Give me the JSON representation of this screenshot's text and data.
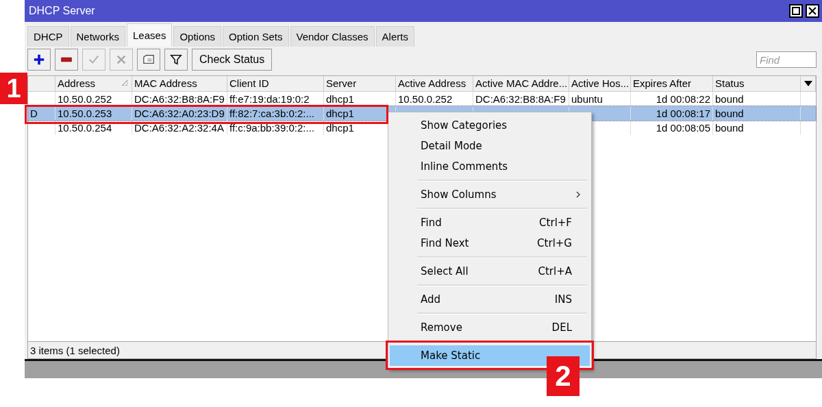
{
  "window": {
    "title": "DHCP Server"
  },
  "tabs": [
    {
      "label": "DHCP",
      "selected": false
    },
    {
      "label": "Networks",
      "selected": false
    },
    {
      "label": "Leases",
      "selected": true
    },
    {
      "label": "Options",
      "selected": false
    },
    {
      "label": "Option Sets",
      "selected": false
    },
    {
      "label": "Vendor Classes",
      "selected": false
    },
    {
      "label": "Alerts",
      "selected": false
    }
  ],
  "toolbar": {
    "buttons": [
      {
        "kind": "add",
        "disabled": false
      },
      {
        "kind": "remove",
        "disabled": false
      },
      {
        "kind": "enable",
        "disabled": true
      },
      {
        "kind": "disable",
        "disabled": true
      },
      {
        "kind": "comment",
        "disabled": false
      },
      {
        "kind": "filter",
        "disabled": false
      }
    ],
    "check_status": "Check Status",
    "search": {
      "placeholder": "Find"
    }
  },
  "table": {
    "columns": [
      {
        "sorted": false
      },
      {
        "label": "Address",
        "sorted": true
      },
      {
        "label": "MAC Address",
        "sorted": false
      },
      {
        "label": "Client ID",
        "sorted": false
      },
      {
        "label": "Server",
        "sorted": false
      },
      {
        "label": "Active Address",
        "sorted": false
      },
      {
        "label": "Active MAC Addre...",
        "sorted": false
      },
      {
        "label": "Active Hos...",
        "sorted": false
      },
      {
        "label": "Expires After",
        "sorted": false
      },
      {
        "label": "Status",
        "sorted": false
      }
    ],
    "rows": [
      {
        "selected": false,
        "cells": [
          "",
          "10.50.0.252",
          "DC:A6:32:B8:8A:F9",
          "ff:e7:19:da:19:0:2",
          "dhcp1",
          "10.50.0.252",
          "DC:A6:32:B8:8A:F9",
          "ubuntu",
          "1d 00:08:22",
          "bound"
        ]
      },
      {
        "selected": true,
        "cells": [
          "D",
          "10.50.0.253",
          "DC:A6:32:A0:23:D9",
          "ff:82:7:ca:3b:0:2:...",
          "dhcp1",
          "",
          "",
          "",
          "1d 00:08:17",
          "bound"
        ]
      },
      {
        "selected": false,
        "cells": [
          "",
          "10.50.0.254",
          "DC:A6:32:A2:32:4A",
          "ff:c:9a:bb:39:0:2:...",
          "dhcp1",
          "",
          "",
          "",
          "1d 00:08:05",
          "bound"
        ]
      }
    ]
  },
  "status_bar": "3 items (1 selected)",
  "context_menu": {
    "groups": [
      [
        {
          "label": "Show Categories",
          "submenu": false,
          "selected": false
        },
        {
          "label": "Detail Mode",
          "submenu": false,
          "selected": false
        },
        {
          "label": "Inline Comments",
          "submenu": false,
          "selected": false
        }
      ],
      [
        {
          "label": "Show Columns",
          "submenu": true,
          "selected": false
        }
      ],
      [
        {
          "label": "Find",
          "shortcut": "Ctrl+F",
          "submenu": false,
          "selected": false
        },
        {
          "label": "Find Next",
          "shortcut": "Ctrl+G",
          "submenu": false,
          "selected": false
        }
      ],
      [
        {
          "label": "Select All",
          "shortcut": "Ctrl+A",
          "submenu": false,
          "selected": false
        }
      ],
      [
        {
          "label": "Add",
          "shortcut": "INS",
          "submenu": false,
          "selected": false
        }
      ],
      [
        {
          "label": "Remove",
          "shortcut": "DEL",
          "submenu": false,
          "selected": false
        }
      ],
      [
        {
          "label": "Make Static",
          "submenu": false,
          "selected": true
        }
      ]
    ]
  },
  "callouts": [
    "1",
    "2"
  ]
}
